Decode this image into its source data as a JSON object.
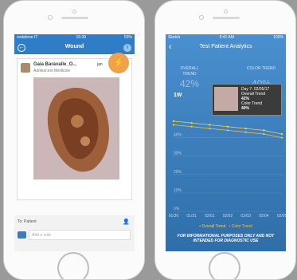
{
  "left": {
    "status": {
      "carrier": "vodafone IT",
      "time": "15:39",
      "battery": "53%"
    },
    "nav": {
      "title": "Wound"
    },
    "post": {
      "name": "Gaia Baravalle_O...",
      "role": "Adolescent Medicine",
      "date": "jan"
    },
    "composer": {
      "to_label": "To: Patient",
      "note_placeholder": "Add a note"
    }
  },
  "right": {
    "status": {
      "carrier": "Sketch",
      "time": "9:41 AM",
      "battery": "100%"
    },
    "nav": {
      "title": "Test Patient Analytics"
    },
    "overall": {
      "label": "OVERALL TREND",
      "value": "42%"
    },
    "color": {
      "label": "COLOR TREND",
      "value": "40%"
    },
    "range_label": "1W",
    "tooltip": {
      "title": "Day 7: 02/05/17",
      "l1": "Overall Trend",
      "v1": "42%",
      "l2": "Color Trend",
      "v2": "40%"
    },
    "legend": {
      "overall": "Overall Trend",
      "color": "Color Trend"
    },
    "disclaimer": "FOR INFORMATIONAL PURPOSES ONLY AND NOT INTENDED FOR DIAGNOSTIC USE"
  },
  "chart_data": {
    "type": "line",
    "x": [
      "01/30",
      "01/31",
      "02/01",
      "02/02",
      "02/03",
      "02/04",
      "02/05"
    ],
    "yticks": [
      "0%",
      "10%",
      "20%",
      "30%",
      "40%"
    ],
    "ylim": [
      0,
      55
    ],
    "series": [
      {
        "name": "Overall Trend",
        "values": [
          49,
          48,
          47,
          46,
          45,
          44,
          42
        ],
        "color": "#f3d34a"
      },
      {
        "name": "Color Trend",
        "values": [
          47,
          46,
          45,
          44,
          43,
          42,
          40
        ],
        "color": "#f3c13a"
      }
    ]
  }
}
